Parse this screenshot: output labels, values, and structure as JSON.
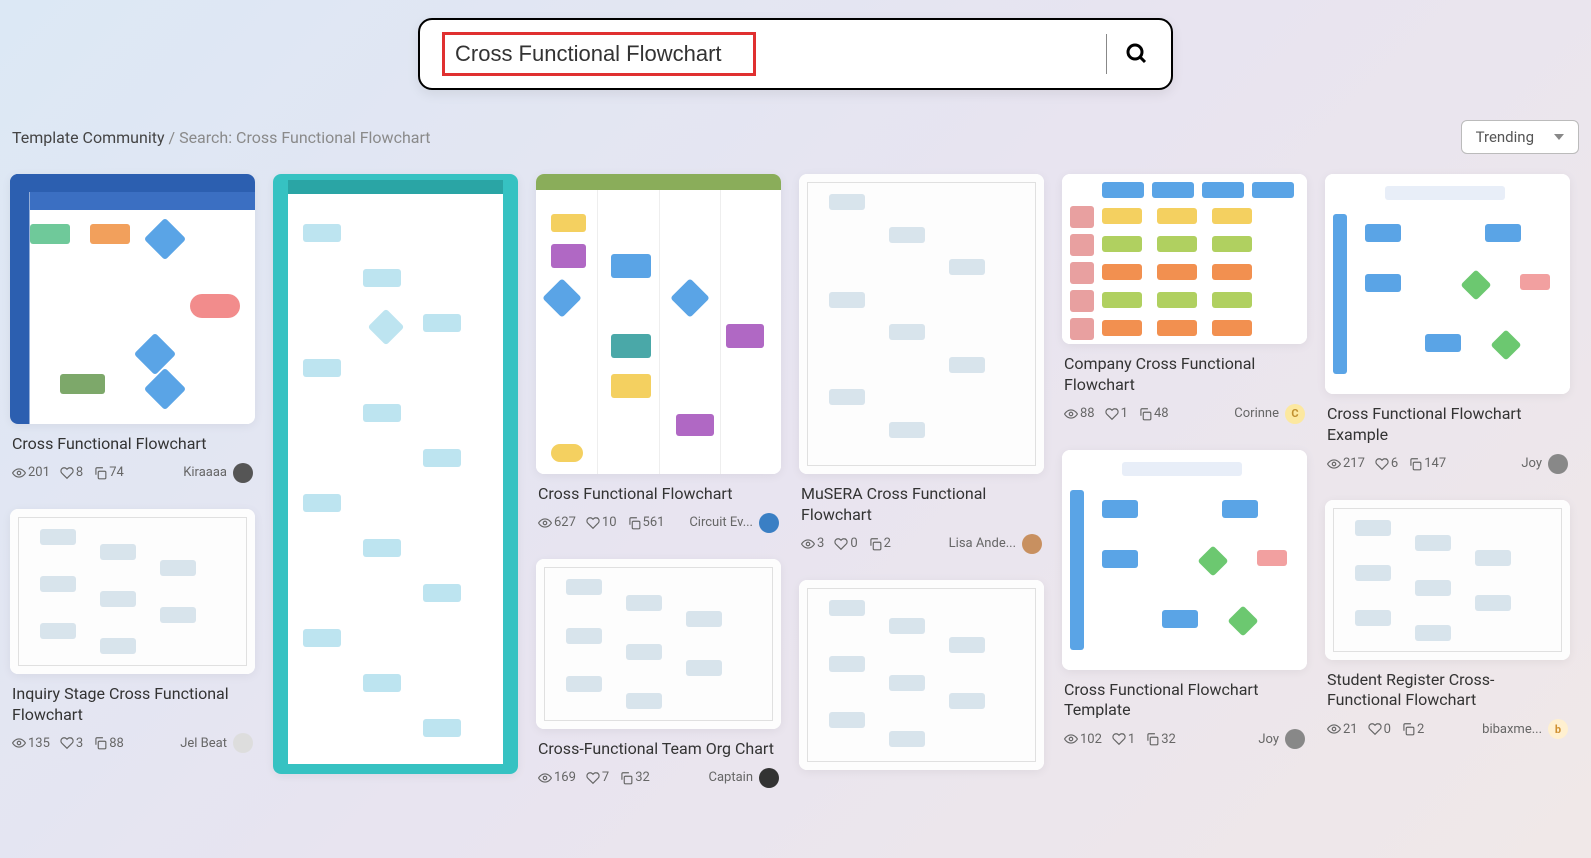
{
  "search": {
    "value": "Cross Functional Flowchart"
  },
  "breadcrumb": {
    "root": "Template Community",
    "sep": "/",
    "current": "Search: Cross Functional Flowchart"
  },
  "sort": {
    "selected": "Trending"
  },
  "columns": [
    [
      {
        "title": "Cross Functional Flowchart",
        "views": "201",
        "likes": "8",
        "copies": "74",
        "author": "Kiraaaa",
        "avatar_bg": "#555",
        "avatar_fg": "#fff",
        "avatar_txt": "",
        "thumb_h": 250,
        "thumb_class": "t-swim"
      },
      {
        "title": "Inquiry Stage Cross Functional Flowchart",
        "views": "135",
        "likes": "3",
        "copies": "88",
        "author": "Jel Beat",
        "avatar_bg": "#ddd",
        "avatar_fg": "#333",
        "avatar_txt": "",
        "thumb_h": 165,
        "thumb_class": "t-generic"
      }
    ],
    [
      {
        "title": "",
        "views": "",
        "likes": "",
        "copies": "",
        "author": "",
        "avatar_bg": "",
        "avatar_fg": "",
        "avatar_txt": "",
        "thumb_h": 600,
        "thumb_class": "t-teal",
        "no_body": true
      }
    ],
    [
      {
        "title": "Cross Functional Flowchart",
        "views": "627",
        "likes": "10",
        "copies": "561",
        "author": "Circuit Ev...",
        "avatar_bg": "#3a7fc4",
        "avatar_fg": "#fff",
        "avatar_txt": "",
        "thumb_h": 300,
        "thumb_class": "t-elec"
      },
      {
        "title": "Cross-Functional Team Org Chart",
        "views": "169",
        "likes": "7",
        "copies": "32",
        "author": "Captain",
        "avatar_bg": "#333",
        "avatar_fg": "#fff",
        "avatar_txt": "",
        "thumb_h": 170,
        "thumb_class": "t-generic"
      }
    ],
    [
      {
        "title": "MuSERA Cross Functional Flowchart",
        "views": "3",
        "likes": "0",
        "copies": "2",
        "author": "Lisa Ande...",
        "avatar_bg": "#c89060",
        "avatar_fg": "#fff",
        "avatar_txt": "",
        "thumb_h": 300,
        "thumb_class": "t-generic"
      },
      {
        "title": "",
        "views": "",
        "likes": "",
        "copies": "",
        "author": "",
        "avatar_bg": "",
        "avatar_fg": "",
        "avatar_txt": "",
        "thumb_h": 190,
        "thumb_class": "t-generic",
        "no_body": true
      }
    ],
    [
      {
        "title": "Company Cross Functional Flowchart",
        "views": "88",
        "likes": "1",
        "copies": "48",
        "author": "Corinne",
        "avatar_bg": "#fce8a0",
        "avatar_fg": "#c09030",
        "avatar_txt": "C",
        "thumb_h": 170,
        "thumb_class": "t-colorbar"
      },
      {
        "title": "Cross Functional Flowchart Template",
        "views": "102",
        "likes": "1",
        "copies": "32",
        "author": "Joy",
        "avatar_bg": "#888",
        "avatar_fg": "#fff",
        "avatar_txt": "",
        "thumb_h": 220,
        "thumb_class": "t-soft"
      }
    ],
    [
      {
        "title": "Cross Functional Flowchart Example",
        "views": "217",
        "likes": "6",
        "copies": "147",
        "author": "Joy",
        "avatar_bg": "#888",
        "avatar_fg": "#fff",
        "avatar_txt": "",
        "thumb_h": 220,
        "thumb_class": "t-soft"
      },
      {
        "title": "Student Register Cross-Functional Flowchart",
        "views": "21",
        "likes": "0",
        "copies": "2",
        "author": "bibaxme...",
        "avatar_bg": "#fff0d0",
        "avatar_fg": "#d09030",
        "avatar_txt": "b",
        "thumb_h": 160,
        "thumb_class": "t-generic"
      }
    ]
  ]
}
